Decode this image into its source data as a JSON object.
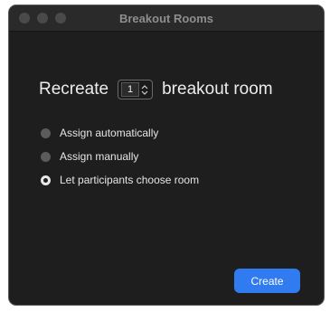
{
  "window": {
    "title": "Breakout Rooms"
  },
  "recreate": {
    "prefix": "Recreate",
    "count": "1",
    "suffix": "breakout room"
  },
  "options": [
    {
      "label": "Assign automatically",
      "selected": false
    },
    {
      "label": "Assign manually",
      "selected": false
    },
    {
      "label": "Let participants choose room",
      "selected": true
    }
  ],
  "footer": {
    "create_label": "Create"
  },
  "colors": {
    "window_background": "#1e1e1e",
    "titlebar": "#2a2a2a",
    "accent": "#2f7bef",
    "text": "#ececec"
  },
  "icons": {
    "window_controls": [
      "close-button-icon",
      "minimize-button-icon",
      "zoom-button-icon"
    ],
    "stepper": "up-down-stepper-icon"
  }
}
